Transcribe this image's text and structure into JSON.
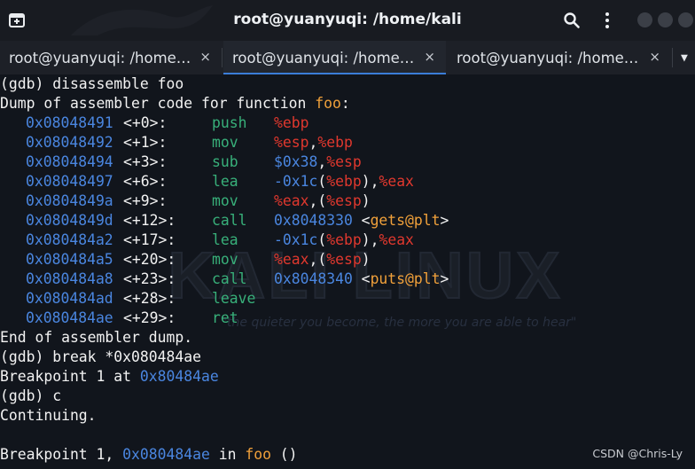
{
  "window": {
    "title": "root@yuanyuqi: /home/kali"
  },
  "tabs": [
    {
      "label": "root@yuanyuqi: /home…",
      "close": "×"
    },
    {
      "label": "root@yuanyuqi: /home…",
      "close": "×"
    },
    {
      "label": "root@yuanyuqi: /home…",
      "close": "×"
    }
  ],
  "colors": {
    "background": "#11151c",
    "address": "#4a86e0",
    "opcode": "#38b07a",
    "register": "#e0382e",
    "symbol": "#f0a03a"
  },
  "terminal": {
    "cmd1": "(gdb) disassemble foo",
    "dump_prefix": "Dump of assembler code for function ",
    "dump_func": "foo",
    "dump_suffix": ":",
    "asm": [
      {
        "addr": "0x08048491",
        "off": "<+0>:",
        "op": "push",
        "args": [
          {
            "t": "%ebp",
            "c": "reg"
          }
        ]
      },
      {
        "addr": "0x08048492",
        "off": "<+1>:",
        "op": "mov",
        "args": [
          {
            "t": "%esp",
            "c": "reg"
          },
          {
            "t": ",",
            "c": "plain"
          },
          {
            "t": "%ebp",
            "c": "reg"
          }
        ]
      },
      {
        "addr": "0x08048494",
        "off": "<+3>:",
        "op": "sub",
        "args": [
          {
            "t": "$0x38",
            "c": "num"
          },
          {
            "t": ",",
            "c": "plain"
          },
          {
            "t": "%esp",
            "c": "reg"
          }
        ]
      },
      {
        "addr": "0x08048497",
        "off": "<+6>:",
        "op": "lea",
        "args": [
          {
            "t": "-0x1c",
            "c": "num"
          },
          {
            "t": "(",
            "c": "plain"
          },
          {
            "t": "%ebp",
            "c": "reg"
          },
          {
            "t": "),",
            "c": "plain"
          },
          {
            "t": "%eax",
            "c": "reg"
          }
        ]
      },
      {
        "addr": "0x0804849a",
        "off": "<+9>:",
        "op": "mov",
        "args": [
          {
            "t": "%eax",
            "c": "reg"
          },
          {
            "t": ",(",
            "c": "plain"
          },
          {
            "t": "%esp",
            "c": "reg"
          },
          {
            "t": ")",
            "c": "plain"
          }
        ]
      },
      {
        "addr": "0x0804849d",
        "off": "<+12>:",
        "op": "call",
        "args": [
          {
            "t": "0x8048330",
            "c": "num"
          },
          {
            "t": " <",
            "c": "plain"
          },
          {
            "t": "gets@plt",
            "c": "sym"
          },
          {
            "t": ">",
            "c": "plain"
          }
        ]
      },
      {
        "addr": "0x080484a2",
        "off": "<+17>:",
        "op": "lea",
        "args": [
          {
            "t": "-0x1c",
            "c": "num"
          },
          {
            "t": "(",
            "c": "plain"
          },
          {
            "t": "%ebp",
            "c": "reg"
          },
          {
            "t": "),",
            "c": "plain"
          },
          {
            "t": "%eax",
            "c": "reg"
          }
        ]
      },
      {
        "addr": "0x080484a5",
        "off": "<+20>:",
        "op": "mov",
        "args": [
          {
            "t": "%eax",
            "c": "reg"
          },
          {
            "t": ",(",
            "c": "plain"
          },
          {
            "t": "%esp",
            "c": "reg"
          },
          {
            "t": ")",
            "c": "plain"
          }
        ]
      },
      {
        "addr": "0x080484a8",
        "off": "<+23>:",
        "op": "call",
        "args": [
          {
            "t": "0x8048340",
            "c": "num"
          },
          {
            "t": " <",
            "c": "plain"
          },
          {
            "t": "puts@plt",
            "c": "sym"
          },
          {
            "t": ">",
            "c": "plain"
          }
        ]
      },
      {
        "addr": "0x080484ad",
        "off": "<+28>:",
        "op": "leave",
        "args": []
      },
      {
        "addr": "0x080484ae",
        "off": "<+29>:",
        "op": "ret",
        "args": []
      }
    ],
    "end_dump": "End of assembler dump.",
    "cmd2": "(gdb) break *0x080484ae",
    "bp_prefix": "Breakpoint 1 at ",
    "bp_addr": "0x80484ae",
    "cmd3": "(gdb) c",
    "continuing": "Continuing.",
    "hit_prefix": "Breakpoint 1, ",
    "hit_addr": "0x080484ae",
    "hit_in": " in ",
    "hit_func": "foo",
    "hit_suffix": " ()"
  },
  "background_watermark": {
    "wordmark": "KALI LINUX",
    "tagline": "\"the quieter you become, the more you are able to hear\""
  },
  "csdn_watermark": "CSDN @Chris-Ly"
}
